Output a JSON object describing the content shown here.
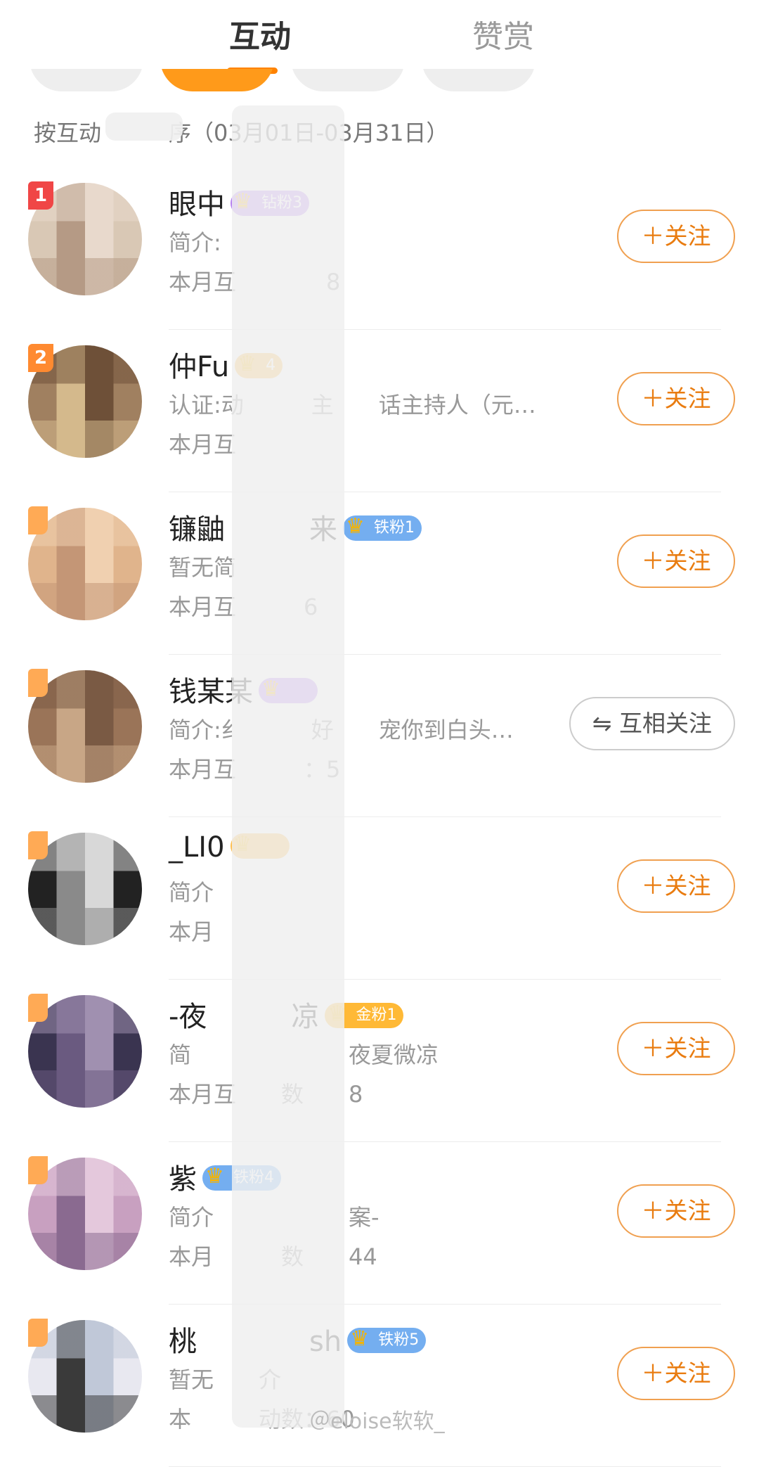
{
  "tabs": [
    {
      "label": "互动",
      "active": true
    },
    {
      "label": "赞赏",
      "active": false
    }
  ],
  "subtitle": "按互动　　　序（03月01日-03月31日）",
  "colors": {
    "accent": "#ff8200",
    "follow_text": "#e97c10"
  },
  "users": [
    {
      "rank": "1",
      "rank_color": "#f04646",
      "name": "眼中",
      "badge": "钻粉3",
      "badge_color": "#b47ef0",
      "desc": "简介:",
      "count": "本月互　　　　8",
      "button": "＋关注",
      "mutual": false,
      "avatar": [
        "#d9c8b5",
        "#b59a85",
        "#e8d9cc"
      ]
    },
    {
      "rank": "2",
      "rank_color": "#ff8a30",
      "name": "仲Fu",
      "badge": "4",
      "badge_color": "#ffbd4a",
      "desc": "认证:动　　　主　　话主持人（元…",
      "count": "本月互",
      "button": "＋关注",
      "mutual": false,
      "avatar": [
        "#a08060",
        "#d4b98c",
        "#6e5038"
      ]
    },
    {
      "rank": "",
      "rank_color": "#ffaa55",
      "name": "镰鼬　　　来",
      "badge": "铁粉1",
      "badge_color": "#74aef0",
      "desc": "暂无简",
      "count": "本月互　　　6",
      "button": "＋关注",
      "mutual": false,
      "avatar": [
        "#e0b48c",
        "#c49676",
        "#f0d0b0"
      ]
    },
    {
      "rank": "",
      "rank_color": "#ffaa55",
      "name": "钱某某",
      "badge": "",
      "badge_color": "#b47ef0",
      "desc": "简介:纟　　　好　　宠你到白头…",
      "count": "本月互　　　：5",
      "button": "⇋ 互相关注",
      "mutual": true,
      "avatar": [
        "#9a7458",
        "#c8a686",
        "#7a5a44"
      ]
    },
    {
      "rank": "",
      "rank_color": "#ffaa55",
      "name": "_LI0",
      "badge": "",
      "badge_color": "#ffbd4a",
      "desc": "简介",
      "count": "本月",
      "button": "＋关注",
      "mutual": false,
      "avatar": [
        "#222222",
        "#8a8a8a",
        "#d8d8d8"
      ]
    },
    {
      "rank": "",
      "rank_color": "#ffaa55",
      "name": "-夜　　　凉",
      "badge": "金粉1",
      "badge_color": "#ffb936",
      "desc": "简　　　　　　　夜夏微凉",
      "count": "本月互　　数　　8",
      "button": "＋关注",
      "mutual": false,
      "avatar": [
        "#3a3450",
        "#6a5a80",
        "#a090b0"
      ]
    },
    {
      "rank": "",
      "rank_color": "#ffaa55",
      "name": "紫",
      "badge": "铁粉4",
      "badge_color": "#74aef0",
      "desc": "简介　　　　　　案-",
      "count": "本月　　　数　　44",
      "button": "＋关注",
      "mutual": false,
      "avatar": [
        "#c8a0c0",
        "#8a6a90",
        "#e4c8dc"
      ]
    },
    {
      "rank": "",
      "rank_color": "#ffaa55",
      "name": "桃　　　　sh",
      "badge": "铁粉5",
      "badge_color": "#74aef0",
      "desc": "暂无　　介",
      "count": "本　　　动数：60",
      "button": "＋关注",
      "mutual": false,
      "avatar": [
        "#e8e8f0",
        "#3a3a3a",
        "#c0c8d8"
      ]
    }
  ],
  "watermark": "＠eloise软软_"
}
